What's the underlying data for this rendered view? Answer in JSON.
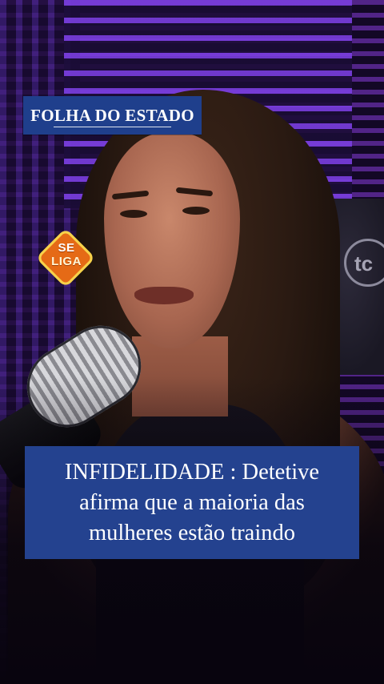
{
  "brand": {
    "name": "FOLHA DO ESTADO"
  },
  "badge": {
    "line1": "SE",
    "line2": "LIGA"
  },
  "chair_logo": {
    "text": "tc"
  },
  "caption": {
    "lines": [
      "INFIDELIDADE : Detetive",
      "afirma que a maioria das",
      "mulheres estão traindo"
    ]
  },
  "colors": {
    "brand_bg": "#1f3f8c",
    "caption_bg": "#24428f",
    "studio_purple": "#7a3ee0",
    "badge_orange": "#e56a16"
  }
}
